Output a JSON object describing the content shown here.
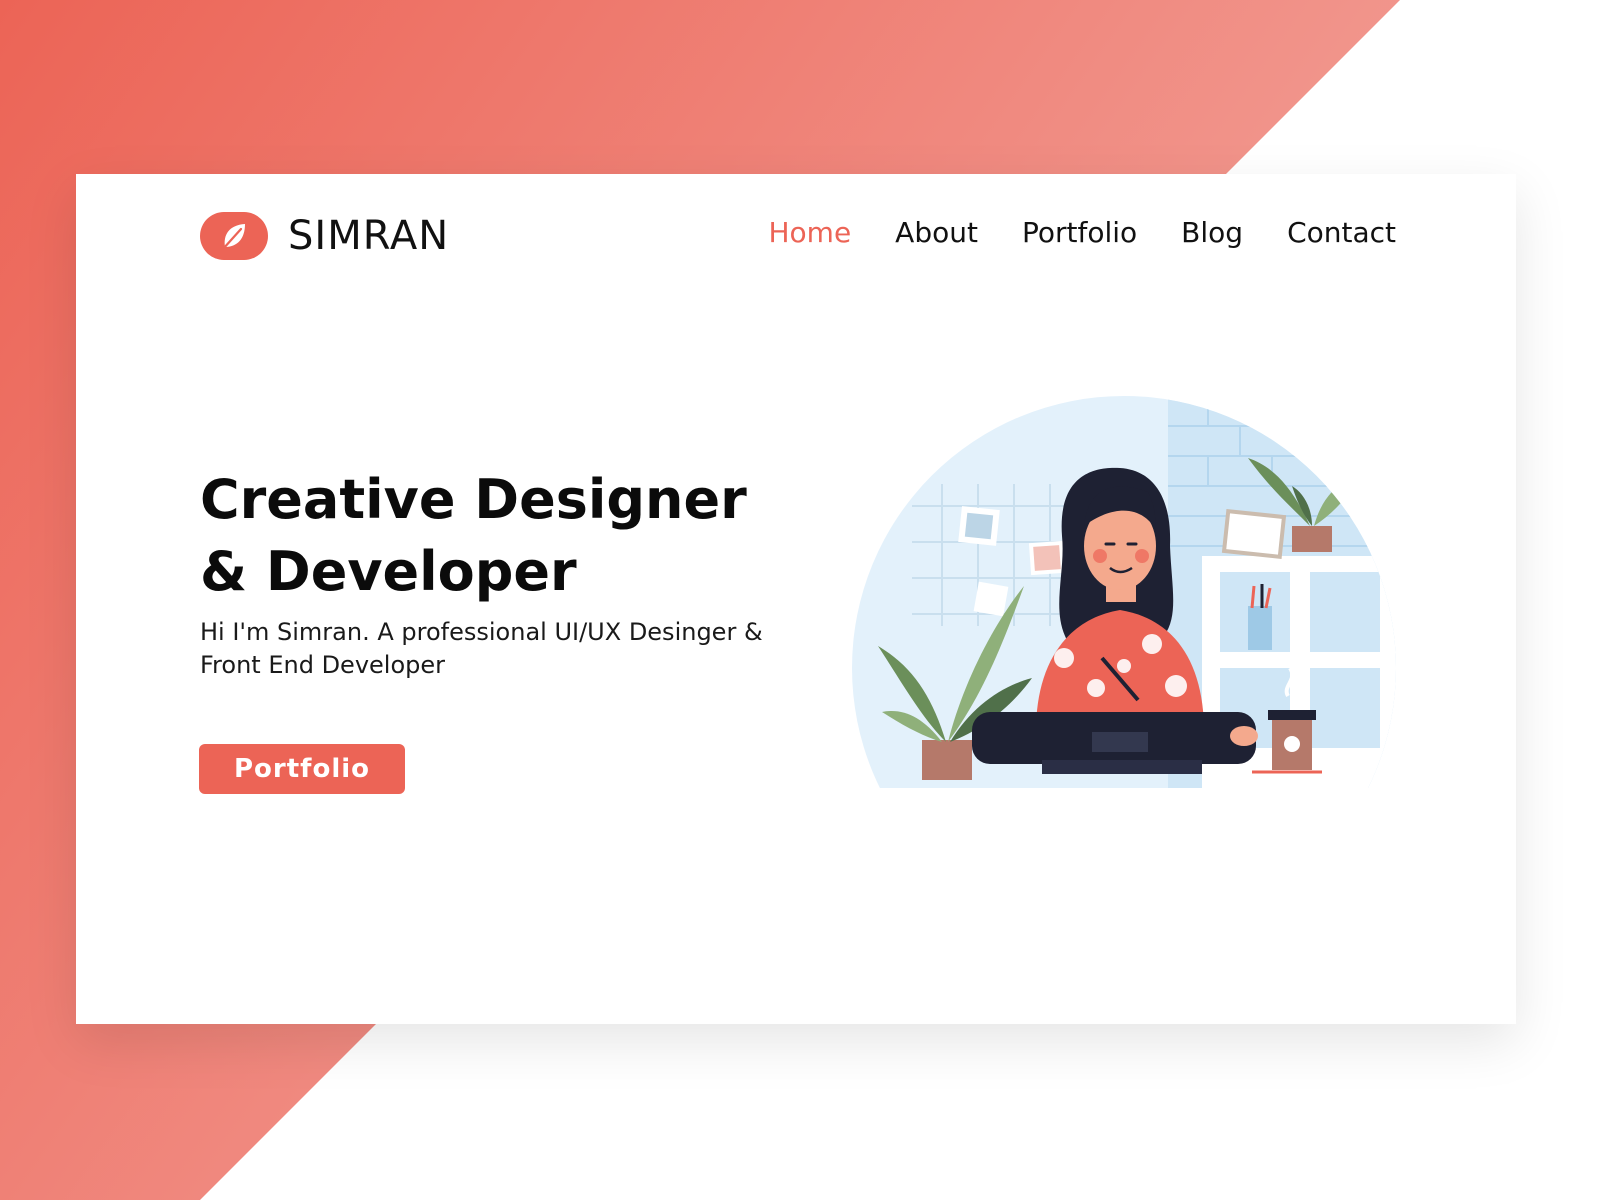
{
  "brand": {
    "name": "SIMRAN",
    "logo_icon": "leaf-icon",
    "accent_color": "#ec6456"
  },
  "nav": {
    "items": [
      {
        "label": "Home",
        "active": true
      },
      {
        "label": "About",
        "active": false
      },
      {
        "label": "Portfolio",
        "active": false
      },
      {
        "label": "Blog",
        "active": false
      },
      {
        "label": "Contact",
        "active": false
      }
    ]
  },
  "hero": {
    "title_line1": "Creative Designer",
    "title_line2": "& Developer",
    "subtitle": "Hi I'm Simran. A professional UI/UX Desinger & Front End Developer",
    "cta_label": "Portfolio"
  },
  "illustration": {
    "subject": "woman-designer-drawing-on-tablet",
    "palette": [
      "#e3f1fb",
      "#bcdcf0",
      "#ec6456",
      "#1e2133",
      "#6b8f5a"
    ]
  }
}
